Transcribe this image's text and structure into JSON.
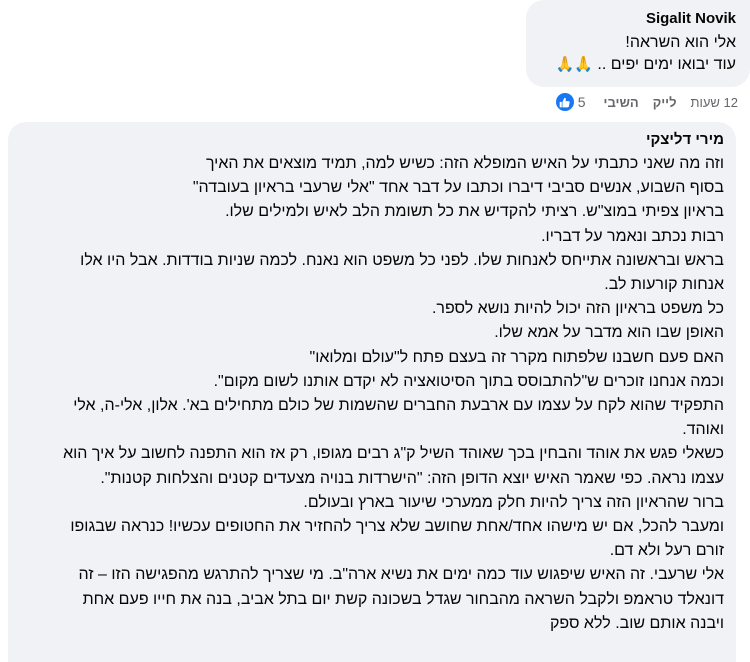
{
  "comment1": {
    "author": "Sigalit Novik",
    "lines": [
      "אלי הוא השראה!",
      "עוד יבואו ימים יפים .."
    ],
    "emoji": "🙏🙏"
  },
  "actions": {
    "time": "12 שעות",
    "like": "לייק",
    "reply": "השיבי",
    "reaction_count": "5"
  },
  "comment2": {
    "author": "מירי דליצקי",
    "lines": [
      "וזה מה שאני כתבתי על האיש המופלא הזה: כשיש למה, תמיד מוצאים את האיך",
      "בסוף השבוע, אנשים סביבי דיברו וכתבו על דבר אחד \"אלי שרעבי בראיון בעובדה\"",
      "בראיון צפיתי במוצ\"ש. רציתי להקדיש את כל תשומת הלב לאיש ולמילים שלו.",
      "רבות נכתב ונאמר על דבריו.",
      "בראש ובראשונה אתייחס לאנחות שלו. לפני כל משפט הוא נאנח. לכמה שניות בודדות. אבל היו אלו",
      "אנחות קורעות לב.",
      "כל משפט בראיון הזה יכול להיות נושא לספר.",
      "האופן שבו הוא מדבר על אמא שלו.",
      "האם פעם חשבנו שלפתוח מקרר זה בעצם פתח ל\"עולם ומלואו\"",
      "וכמה אנחנו זוכרים ש\"להתבוסס בתוך הסיטואציה לא יקדם אותנו לשום מקום\".",
      "התפקיד שהוא לקח על עצמו עם ארבעת החברים שהשמות של כולם מתחילים בא'. אלון, אלי-ה, אלי",
      "ואוהד.",
      "כשאלי פגש את אוהד והבחין בכך שאוהד השיל ק\"ג רבים מגופו, רק אז הוא התפנה לחשוב על איך הוא",
      "עצמו נראה. כפי שאמר האיש יוצא הדופן הזה: \"הישרדות בנויה מצעדים קטנים והצלחות קטנות\".",
      "ברור שהראיון הזה צריך להיות חלק ממערכי שיעור בארץ ובעולם.",
      "ומעבר להכל, אם יש מישהו אחד/אחת שחושב שלא צריך להחזיר את החטופים עכשיו! כנראה שבגופו",
      "זורם רעל ולא דם.",
      "אלי שרעבי. זה האיש שיפגוש עוד כמה ימים את נשיא ארה\"ב. מי שצריך להתרגש מהפגישה הזו – זה",
      "דונאלד טראמפ ולקבל השראה מהבחור שגדל בשכונה קשת יום בתל אביב, בנה את חייו פעם אחת",
      "ויבנה אותם שוב. ללא ספק"
    ]
  }
}
